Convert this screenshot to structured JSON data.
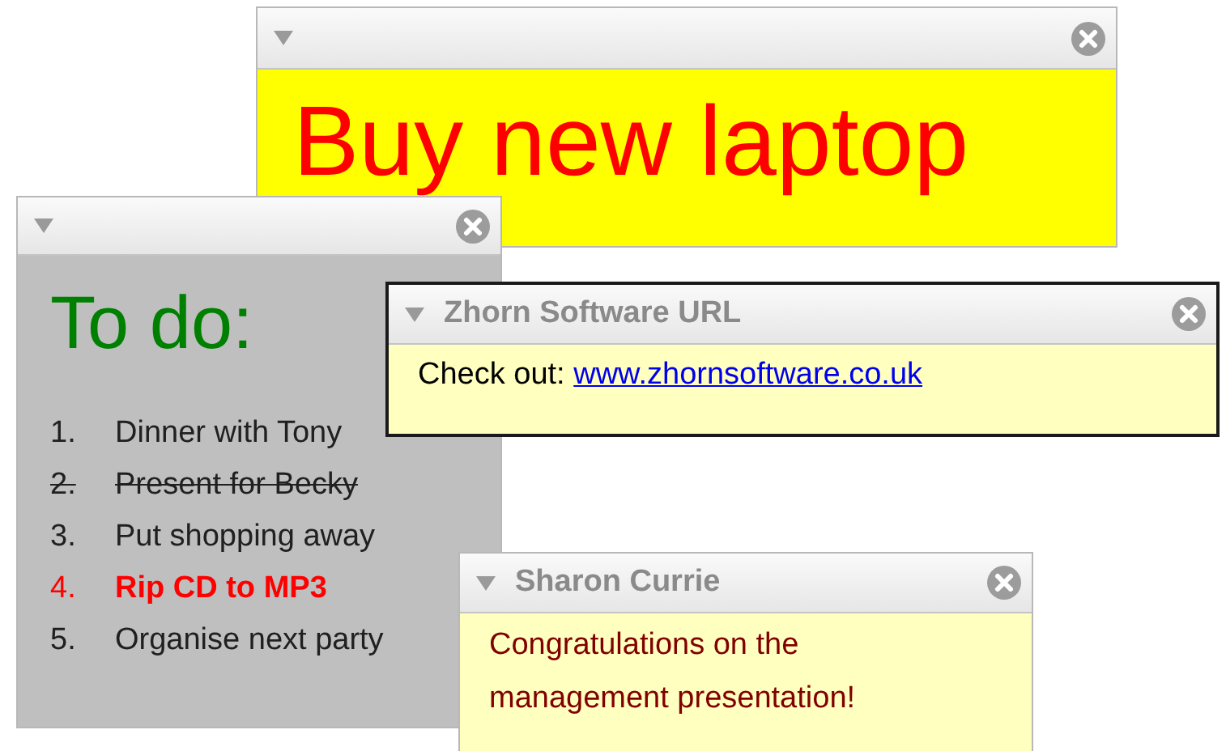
{
  "notes": [
    {
      "kind": "heading",
      "selected": false,
      "color": "#ffff00",
      "text": "Buy new laptop"
    },
    {
      "kind": "list",
      "selected": false,
      "color": "#bfbfbf",
      "text": "To do:",
      "items": [
        {
          "number": "1.",
          "text": "Dinner with Tony",
          "struck": false,
          "important": false
        },
        {
          "number": "2.",
          "text": "Present for Becky",
          "struck": true,
          "important": false
        },
        {
          "number": "3.",
          "text": "Put shopping away",
          "struck": false,
          "important": false
        },
        {
          "number": "4.",
          "text": "Rip CD to MP3",
          "struck": false,
          "important": true
        },
        {
          "number": "5.",
          "text": "Organise next party",
          "struck": false,
          "important": false
        }
      ]
    },
    {
      "kind": "link",
      "title": "Zhorn Software URL",
      "selected": true,
      "color": "#ffffc0",
      "text": "Check out:",
      "link": "www.zhornsoftware.co.uk"
    },
    {
      "kind": "message",
      "title": "Sharon Currie",
      "selected": false,
      "color": "#ffffc0",
      "text": "Congratulations on the management presentation!"
    }
  ]
}
